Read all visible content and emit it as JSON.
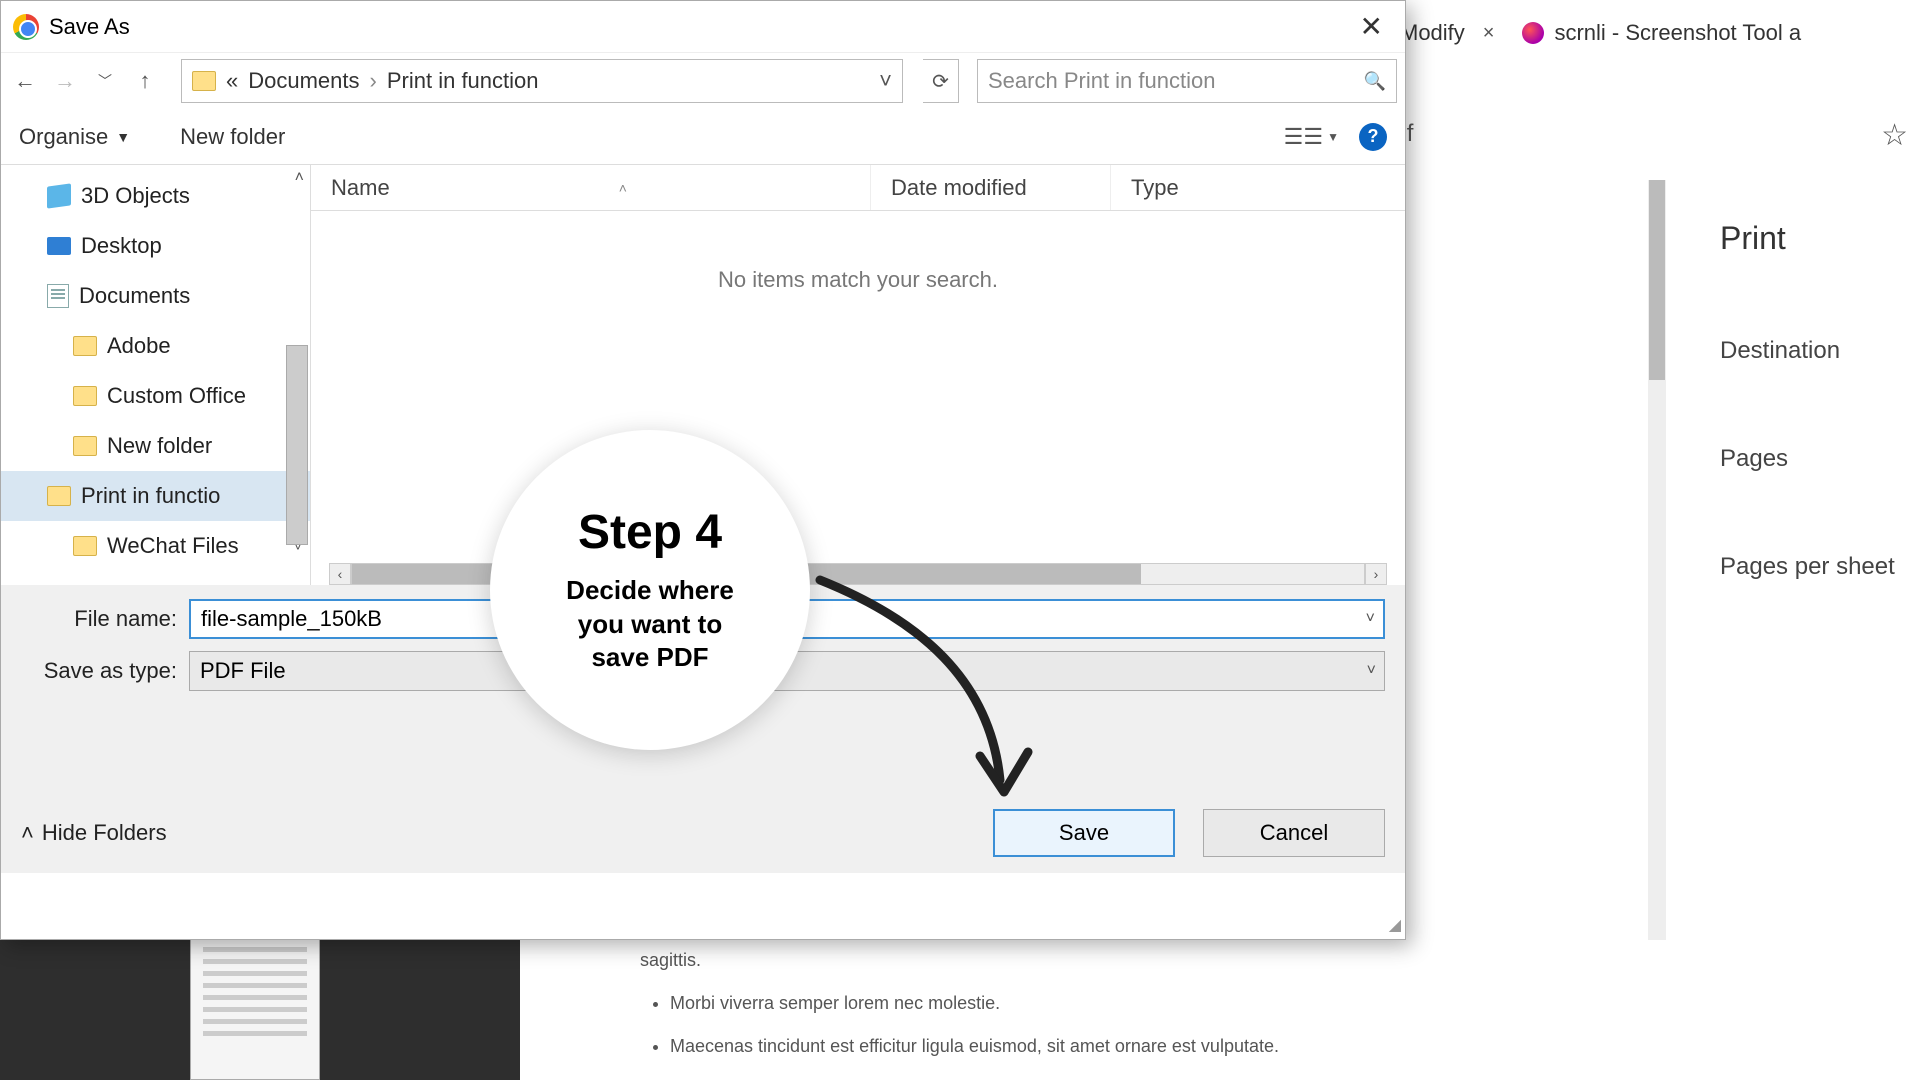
{
  "browser": {
    "tab1_text": "Modify",
    "tab2_text": "scrnli - Screenshot Tool a",
    "address_fragment": "odf"
  },
  "print_panel": {
    "title": "Print",
    "destination": "Destination",
    "pages": "Pages",
    "pages_per_sheet": "Pages per sheet"
  },
  "dialog": {
    "title": "Save As",
    "breadcrumb_prefix": "«",
    "breadcrumb1": "Documents",
    "breadcrumb2": "Print in function",
    "search_placeholder": "Search Print in function",
    "organise": "Organise",
    "new_folder": "New folder",
    "sidebar": {
      "item0": "3D Objects",
      "item1": "Desktop",
      "item2": "Documents",
      "item3": "Adobe",
      "item4": "Custom Office",
      "item5": "New folder",
      "item6": "Print in functio",
      "item7": "WeChat Files"
    },
    "columns": {
      "name": "Name",
      "date": "Date modified",
      "type": "Type"
    },
    "empty_msg": "No items match your search.",
    "filename_label": "File name:",
    "filename_value": "file-sample_150kB",
    "savetype_label": "Save as type:",
    "savetype_value": "PDF File",
    "hide_folders": "Hide Folders",
    "save": "Save",
    "cancel": "Cancel"
  },
  "callout": {
    "step": "Step 4",
    "desc1": "Decide where",
    "desc2": "you want to",
    "desc3": "save PDF"
  },
  "doc_content": {
    "line0": "sagittis.",
    "line1": "Morbi viverra semper lorem nec molestie.",
    "line2": "Maecenas tincidunt est efficitur ligula euismod, sit amet ornare est vulputate."
  }
}
